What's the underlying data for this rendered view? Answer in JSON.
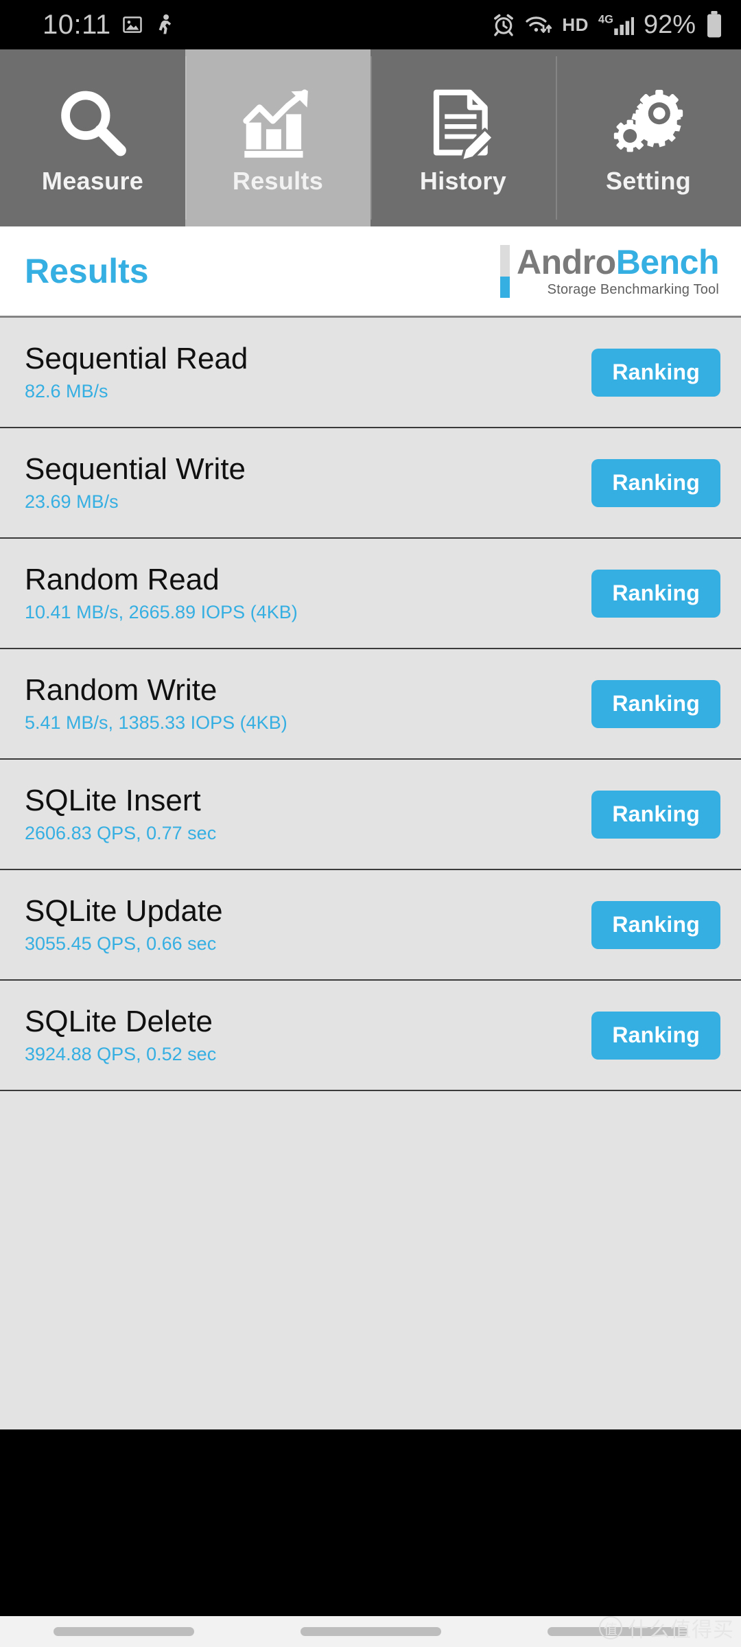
{
  "status_bar": {
    "time": "10:11",
    "left_icons": [
      "image-icon",
      "pedometer-icon"
    ],
    "right_icons": [
      "alarm-icon",
      "wifi-icon",
      "volte-hd-icon",
      "signal-4g-icon",
      "battery-icon"
    ],
    "hd_label": "HD",
    "network_label": "4G",
    "battery_percent": "92%"
  },
  "tabs": [
    {
      "label": "Measure",
      "icon": "search-icon",
      "active": false
    },
    {
      "label": "Results",
      "icon": "chart-icon",
      "active": true
    },
    {
      "label": "History",
      "icon": "document-edit-icon",
      "active": false
    },
    {
      "label": "Setting",
      "icon": "gears-icon",
      "active": false
    }
  ],
  "header": {
    "page_title": "Results",
    "logo_part1": "Andro",
    "logo_part2": "Bench",
    "logo_tagline": "Storage Benchmarking Tool"
  },
  "results": [
    {
      "title": "Sequential Read",
      "value": "82.6 MB/s",
      "button": "Ranking"
    },
    {
      "title": "Sequential Write",
      "value": "23.69 MB/s",
      "button": "Ranking"
    },
    {
      "title": "Random Read",
      "value": "10.41 MB/s, 2665.89 IOPS (4KB)",
      "button": "Ranking"
    },
    {
      "title": "Random Write",
      "value": "5.41 MB/s, 1385.33 IOPS (4KB)",
      "button": "Ranking"
    },
    {
      "title": "SQLite Insert",
      "value": "2606.83 QPS, 0.77 sec",
      "button": "Ranking"
    },
    {
      "title": "SQLite Update",
      "value": "3055.45 QPS, 0.66 sec",
      "button": "Ranking"
    },
    {
      "title": "SQLite Delete",
      "value": "3924.88 QPS, 0.52 sec",
      "button": "Ranking"
    }
  ],
  "watermark": {
    "mark": "值",
    "text": "什么值得买"
  },
  "colors": {
    "accent_blue": "#35aee2",
    "tab_inactive": "#6e6e6e",
    "tab_active": "#b4b4b4",
    "list_bg": "#e3e3e3"
  }
}
